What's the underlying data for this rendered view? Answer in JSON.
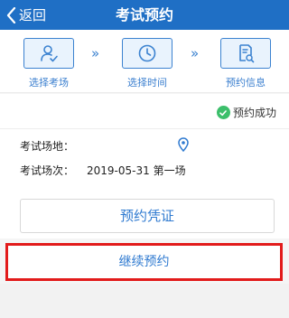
{
  "header": {
    "back_label": "返回",
    "title": "考试预约"
  },
  "steps": [
    {
      "label": "选择考场",
      "icon": "person-check-icon"
    },
    {
      "label": "选择时间",
      "icon": "clock-icon"
    },
    {
      "label": "预约信息",
      "icon": "document-search-icon"
    }
  ],
  "step_arrow": "»",
  "status": {
    "text": "预约成功",
    "color": "#3cbf6b"
  },
  "details": {
    "venue_label": "考试场地：",
    "venue_value": "",
    "session_label": "考试场次：",
    "session_value": "2019-05-31 第一场"
  },
  "buttons": {
    "voucher_label": "预约凭证",
    "continue_label": "继续预约"
  },
  "colors": {
    "brand_blue": "#1f6fc5",
    "accent_blue": "#2f7ad0",
    "highlight_red": "#e21b1b"
  }
}
